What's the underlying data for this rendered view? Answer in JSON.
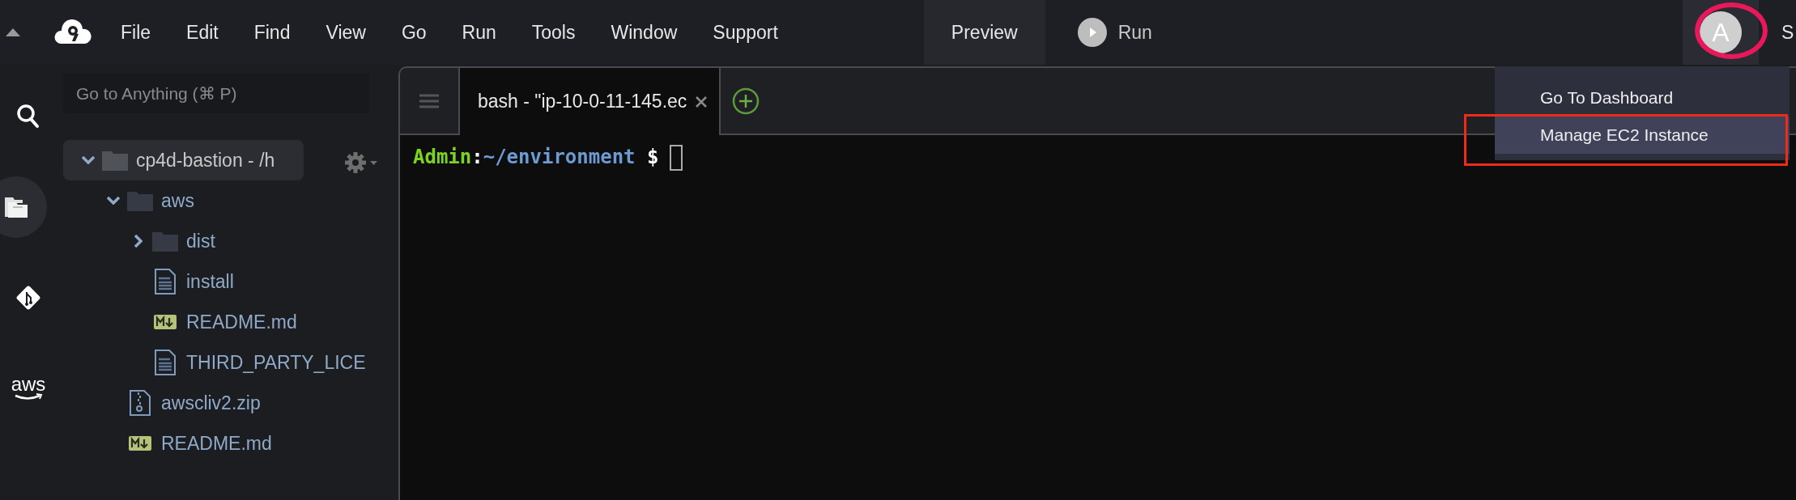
{
  "top_bar": {
    "menu": [
      "File",
      "Edit",
      "Find",
      "View",
      "Go",
      "Run",
      "Tools",
      "Window",
      "Support"
    ],
    "preview": "Preview",
    "run": "Run",
    "avatar": "A",
    "share": "S"
  },
  "user_menu": {
    "items": [
      {
        "label": "Go To Dashboard",
        "selected": false
      },
      {
        "label": "Manage EC2 Instance",
        "selected": true
      }
    ]
  },
  "sidebar": {
    "tools": [
      {
        "kind": "search",
        "selected": false
      },
      {
        "kind": "files",
        "selected": true
      },
      {
        "kind": "git",
        "selected": false
      },
      {
        "kind": "aws",
        "label": "aws",
        "selected": false
      }
    ],
    "search": {
      "placeholder": "Go to Anything (⌘ P)"
    },
    "tree": [
      {
        "name": "cp4d-bastion - /h",
        "kind": "folder",
        "expanded": true,
        "selected": true,
        "children": [
          {
            "name": "aws",
            "kind": "folder",
            "expanded": true,
            "selected": false,
            "children": [
              {
                "name": "dist",
                "kind": "folder",
                "expanded": false,
                "selected": false
              },
              {
                "name": "install",
                "kind": "file",
                "selected": false
              },
              {
                "name": "README.md",
                "kind": "markdown",
                "selected": false
              },
              {
                "name": "THIRD_PARTY_LICE",
                "kind": "file",
                "selected": false
              }
            ]
          },
          {
            "name": "awscliv2.zip",
            "kind": "zip",
            "selected": false
          },
          {
            "name": "README.md",
            "kind": "markdown",
            "selected": false
          }
        ]
      }
    ]
  },
  "terminal": {
    "tabs": [
      {
        "label": "bash - \"ip-10-0-11-145.ec",
        "selected": true
      }
    ],
    "prompt": {
      "user": "Admin",
      "separator": ":",
      "path": "~/environment",
      "symbol": "$"
    }
  },
  "annotations": [
    {
      "kind": "ellipse",
      "color": "#e8185a"
    },
    {
      "kind": "rectangle",
      "color": "#ee2a1a"
    }
  ]
}
